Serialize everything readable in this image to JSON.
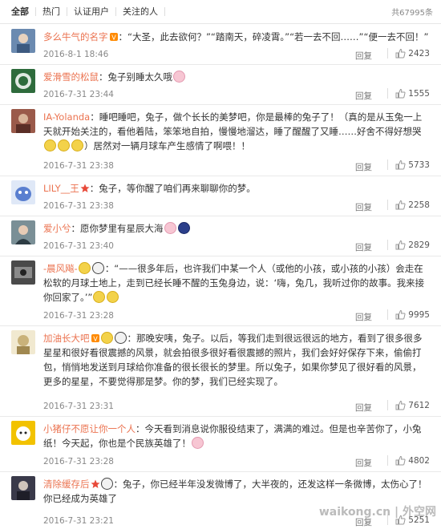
{
  "tabs": [
    "全部",
    "热门",
    "认证用户",
    "关注的人"
  ],
  "total": "共67995条",
  "reply_label": "回复",
  "comments": [
    {
      "name": "多么牛气的名字",
      "text": "：“大圣，此去欲何？”“踏南天，碎凌霄。”“若一去不回……”“便一去不回！”",
      "time": "2016-8-1 18:46",
      "likes": "2423",
      "avatar_color": "#6b8ab0"
    },
    {
      "name": "爱滑雪的松鼠",
      "text": "：兔子别睡太久哦",
      "time": "2016-7-31 23:44",
      "likes": "1555",
      "avatar_color": "#2e6b3c"
    },
    {
      "name": "IA-Yolanda",
      "text": "：睡吧睡吧，兔子，做个长长的美梦吧，你是最棒的兔子了！（真的是从玉兔一上天就开始关注的，看他着陆，笨笨地自拍，慢慢地溜达，睡了醒醒了又睡……好舍不得好想哭",
      "text2": "）居然对一辆月球车产生感情了啊喂！！",
      "time": "2016-7-31 23:38",
      "likes": "5733",
      "avatar_color": "#9a5a4a"
    },
    {
      "name": "LILY__王",
      "text": "：兔子，等你醒了咱们再来聊聊你的梦。",
      "time": "2016-7-31 23:38",
      "likes": "2258",
      "avatar_color": "#5a7fd0"
    },
    {
      "name": "爱小兮",
      "text": "：愿你梦里有星辰大海",
      "time": "2016-7-31 23:40",
      "likes": "2829",
      "avatar_color": "#7a8f96"
    },
    {
      "name": "-晨风飚-",
      "text": "：“——很多年后，也许我们中某一个人（或他的小孩，或小孩的小孩）会走在松软的月球土地上，走到已经长睡不醒的玉兔身边，说：‘嗨，兔几，我听过你的故事。我来接你回家了。’”",
      "time": "2016-7-31 23:28",
      "likes": "9995",
      "avatar_color": "#4a4a4a"
    },
    {
      "name": "加油长大吧",
      "text": "：那晚安咦，兔子。以后，等我们走到很远很远的地方，看到了很多很多星星和很好看很震撼的风景，就会拍很多很好看很震撼的照片，我们会好好保存下来，偷偷打包，悄悄地发送到月球给你准备的很长很长的梦里。所以兔子，如果你梦见了很好看的风景，更多的星星，不要觉得那是梦。你的梦，我们已经实现了。",
      "time": "2016-7-31 23:31",
      "likes": "7612",
      "avatar_color": "#c9b27a"
    },
    {
      "name": "小猪仔不愿让你一个人",
      "text": "：今天看到消息说你服役结束了，满满的难过。但是也辛苦你了，小兔纸！今天起，你也是个民族英雄了！",
      "time": "2016-7-31 23:28",
      "likes": "4802",
      "avatar_color": "#f2c200"
    },
    {
      "name": "清除缓存后",
      "text": "：兔子，你已经半年没发微博了，大半夜的，还发这样一条微博，太伤心了！你已经成为英雄了",
      "time": "2016-7-31 23:21",
      "likes": "5251",
      "avatar_color": "#3a3a4a"
    }
  ],
  "watermark": "waikong.cn | 外空网"
}
